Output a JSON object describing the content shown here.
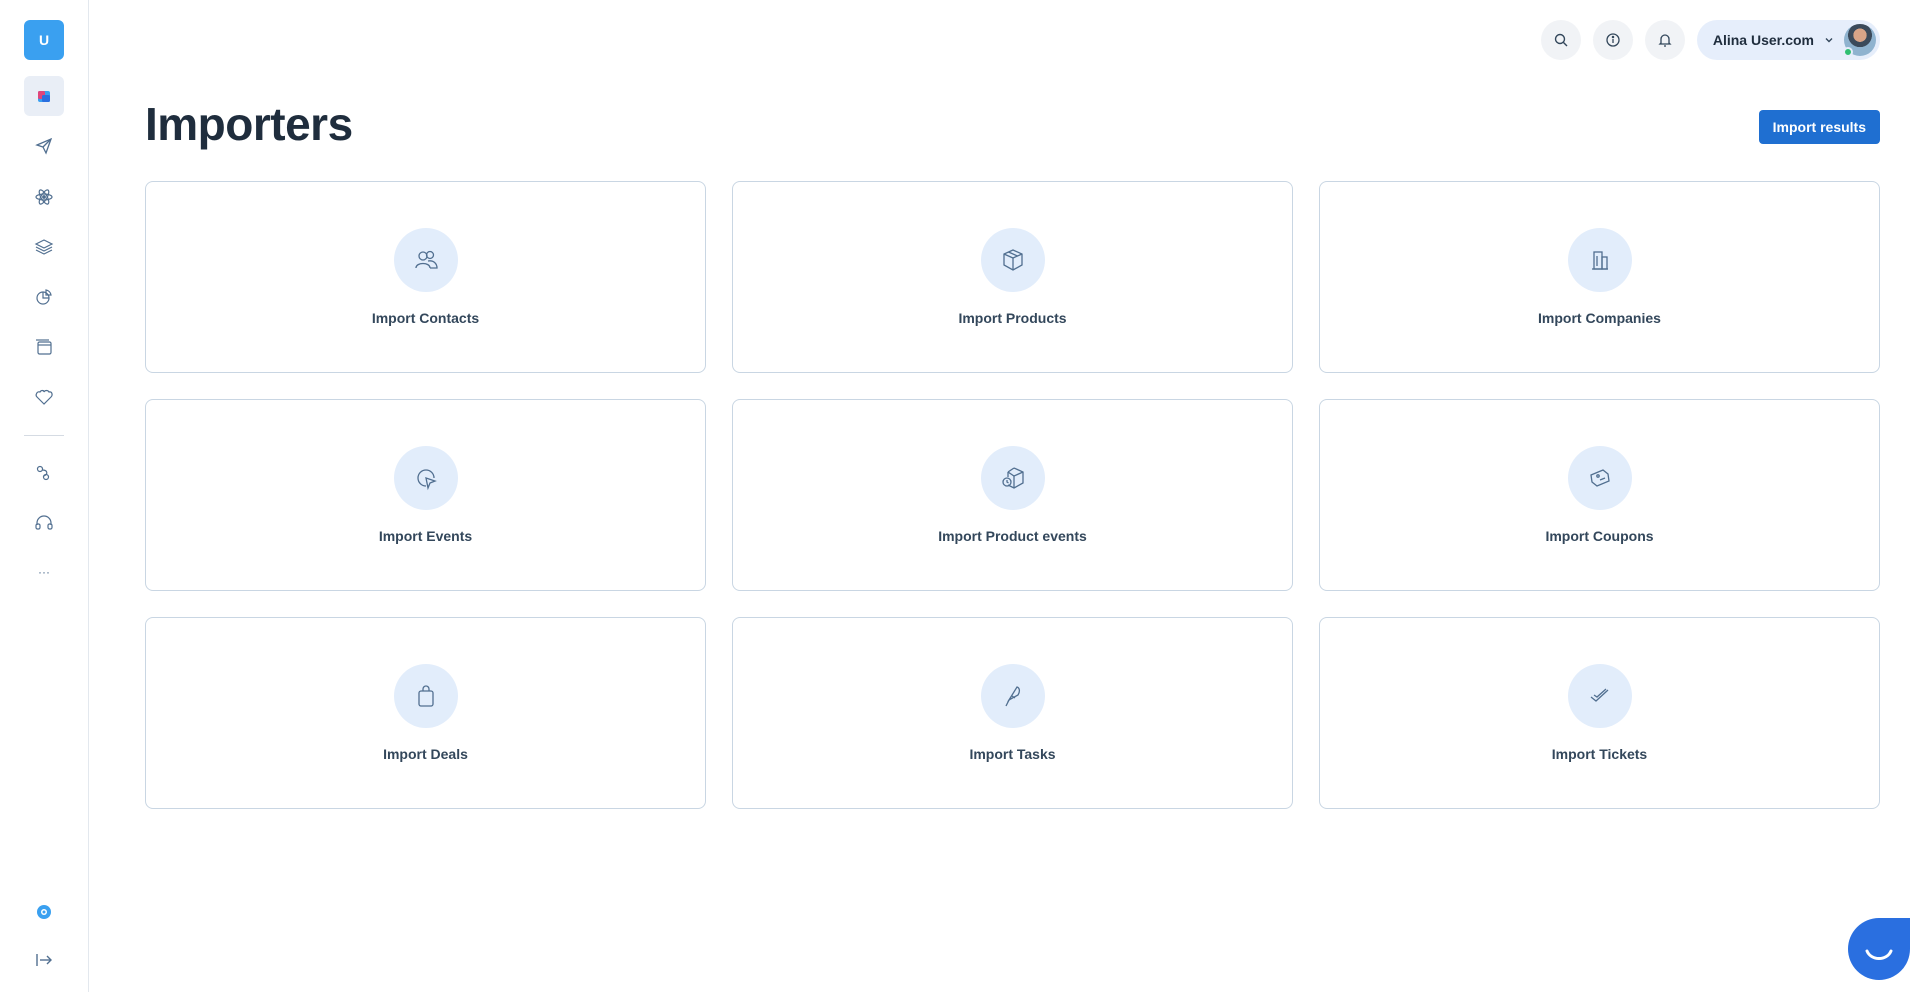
{
  "sidebar": {
    "brand_letter": "U",
    "nav": [
      {
        "name": "dashboard-icon",
        "active": true
      },
      {
        "name": "paper-plane-icon"
      },
      {
        "name": "atom-icon"
      },
      {
        "name": "layers-icon"
      },
      {
        "name": "pie-chart-icon"
      },
      {
        "name": "window-icon"
      },
      {
        "name": "tag-icon"
      },
      {
        "name": "flow-icon"
      },
      {
        "name": "headset-icon"
      },
      {
        "name": "more-icon"
      }
    ],
    "more_label": "···"
  },
  "header": {
    "user_name": "Alina User.com"
  },
  "page": {
    "title": "Importers",
    "import_results_label": "Import results"
  },
  "importers": [
    {
      "label": "Import Contacts",
      "icon": "contacts-icon"
    },
    {
      "label": "Import Products",
      "icon": "box-icon"
    },
    {
      "label": "Import Companies",
      "icon": "building-icon"
    },
    {
      "label": "Import Events",
      "icon": "cursor-click-icon"
    },
    {
      "label": "Import Product events",
      "icon": "box-event-icon"
    },
    {
      "label": "Import Coupons",
      "icon": "coupon-icon"
    },
    {
      "label": "Import Deals",
      "icon": "bag-icon"
    },
    {
      "label": "Import Tasks",
      "icon": "pen-icon"
    },
    {
      "label": "Import Tickets",
      "icon": "check-ticket-icon"
    }
  ],
  "colors": {
    "accent": "#1f6fd1",
    "brand": "#3aa0f0",
    "icon_bg": "#e2edfb",
    "card_border": "#c9d6e3"
  }
}
